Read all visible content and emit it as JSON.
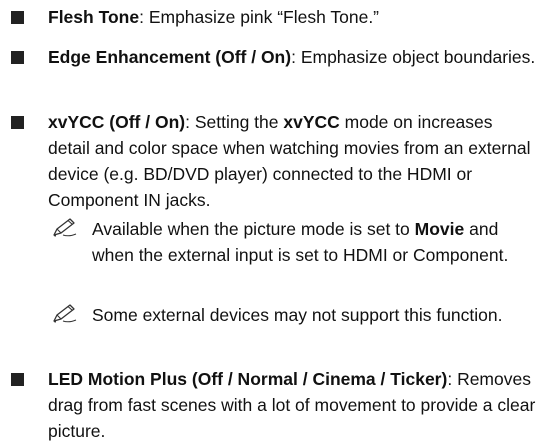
{
  "items": [
    {
      "term": "Flesh Tone",
      "sep": ": ",
      "desc": "Emphasize pink “Flesh Tone.”"
    },
    {
      "term": "Edge Enhancement (Off / On)",
      "sep": ": ",
      "desc": "Emphasize object boundaries."
    },
    {
      "term": "xvYCC (Off / On)",
      "desc_a": ": Setting the ",
      "term_inline": "xvYCC",
      "desc_b": " mode on increases detail and color space when watching movies from an external device (e.g. BD/DVD player) connected to the HDMI or Component IN jacks."
    },
    {
      "term": "LED Motion Plus (Off / Normal / Cinema / Ticker)",
      "sep": ": ",
      "desc": "Removes drag from fast scenes with a lot of movement to provide a clear picture."
    }
  ],
  "notes": [
    {
      "icon": "pencil-note-icon",
      "text_a": "Available when the picture mode is set to ",
      "bold": "Movie",
      "text_b": " and when the external input is set to HDMI or Component."
    },
    {
      "icon": "pencil-note-icon",
      "text": "Some external devices may not support this function."
    }
  ]
}
